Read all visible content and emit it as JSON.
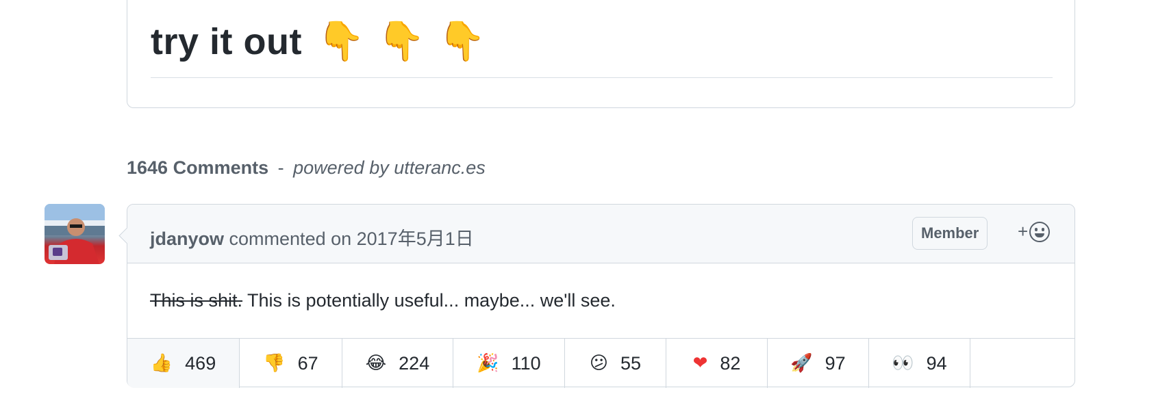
{
  "post": {
    "heading": "try it out",
    "emojis": [
      "👇",
      "👇",
      "👇"
    ]
  },
  "comments_section": {
    "count_text": "1646 Comments",
    "separator": "-",
    "powered_by": "powered by utteranc.es"
  },
  "comment": {
    "author": "jdanyow",
    "action_text": "commented on 2017年5月1日",
    "badge": "Member",
    "add_reaction_label": "+",
    "body_strikethrough": "This is shit.",
    "body_text": "This is potentially useful... maybe... we'll see.",
    "reactions": [
      {
        "emoji": "👍",
        "count": "469",
        "active": true
      },
      {
        "emoji": "👎",
        "count": "67"
      },
      {
        "emoji": "😂",
        "count": "224"
      },
      {
        "emoji": "🎉",
        "count": "110"
      },
      {
        "emoji": "😕",
        "count": "55"
      },
      {
        "emoji": "❤",
        "count": "82"
      },
      {
        "emoji": "🚀",
        "count": "97"
      },
      {
        "emoji": "👀",
        "count": "94"
      }
    ]
  },
  "colors": {
    "accent_heart": "#e33",
    "pointing_emoji": "#f6c22a",
    "border": "#d0d7de",
    "header_bg": "#f6f8fa"
  }
}
